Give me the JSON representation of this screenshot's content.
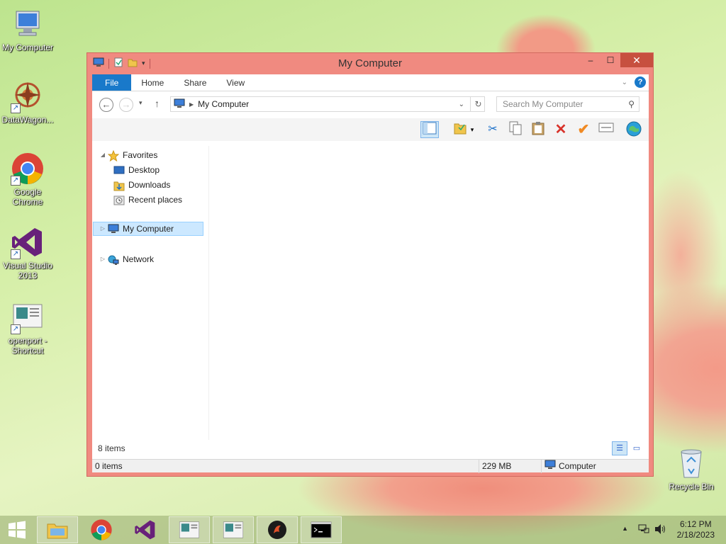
{
  "desktop": {
    "icons": [
      {
        "label": "My Computer",
        "icon": "my-computer-icon"
      },
      {
        "label": "DataWagon...",
        "icon": "datawagon-icon"
      },
      {
        "label": "Google Chrome",
        "icon": "chrome-icon"
      },
      {
        "label": "Visual Studio 2013",
        "icon": "visual-studio-icon"
      },
      {
        "label": "openport - Shortcut",
        "icon": "openport-icon"
      }
    ],
    "recycle_bin": "Recycle Bin"
  },
  "window": {
    "title": "My Computer",
    "controls": {
      "minimize": "–",
      "maximize": "☐",
      "close": "✕"
    },
    "ribbon_tabs": [
      "File",
      "Home",
      "Share",
      "View"
    ],
    "address": {
      "path": "My Computer"
    },
    "search": {
      "placeholder": "Search My Computer"
    },
    "nav_pane": {
      "favorites": "Favorites",
      "favorites_items": [
        "Desktop",
        "Downloads",
        "Recent places"
      ],
      "my_computer": "My Computer",
      "network": "Network"
    },
    "items_count": "8 items",
    "statusbar": {
      "selected": "0 items",
      "size": "229 MB",
      "location": "Computer"
    }
  },
  "taskbar": {
    "clock_time": "6:12 PM",
    "clock_date": "2/18/2023"
  },
  "colors": {
    "window_frame": "#f08a80",
    "file_tab": "#1979ca",
    "close_button": "#c7503f",
    "selection": "#cce8ff"
  }
}
